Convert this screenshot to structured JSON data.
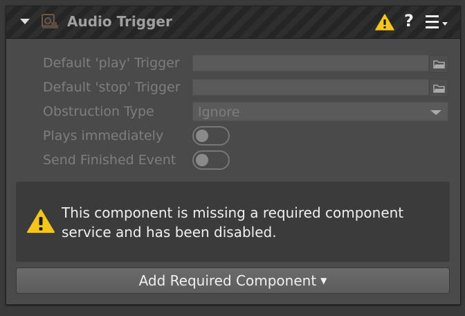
{
  "component": {
    "title": "Audio Trigger",
    "icon": "audio-trigger-icon",
    "header_icons": [
      "collapse-arrow-icon",
      "warning-icon",
      "help-icon",
      "menu-icon"
    ]
  },
  "properties": {
    "play_trigger_label": "Default 'play' Trigger",
    "play_trigger_value": "",
    "stop_trigger_label": "Default 'stop' Trigger",
    "stop_trigger_value": "",
    "obstruction_label": "Obstruction Type",
    "obstruction_value": "Ignore",
    "plays_immediately_label": "Plays immediately",
    "plays_immediately_on": false,
    "send_finished_label": "Send Finished Event",
    "send_finished_on": false
  },
  "warning": {
    "message": "This component is missing a required component service and has been disabled."
  },
  "add_button": {
    "label": "Add Required Component"
  },
  "colors": {
    "warning_yellow": "#f5c518",
    "text_disabled": "#7e7e7e"
  }
}
